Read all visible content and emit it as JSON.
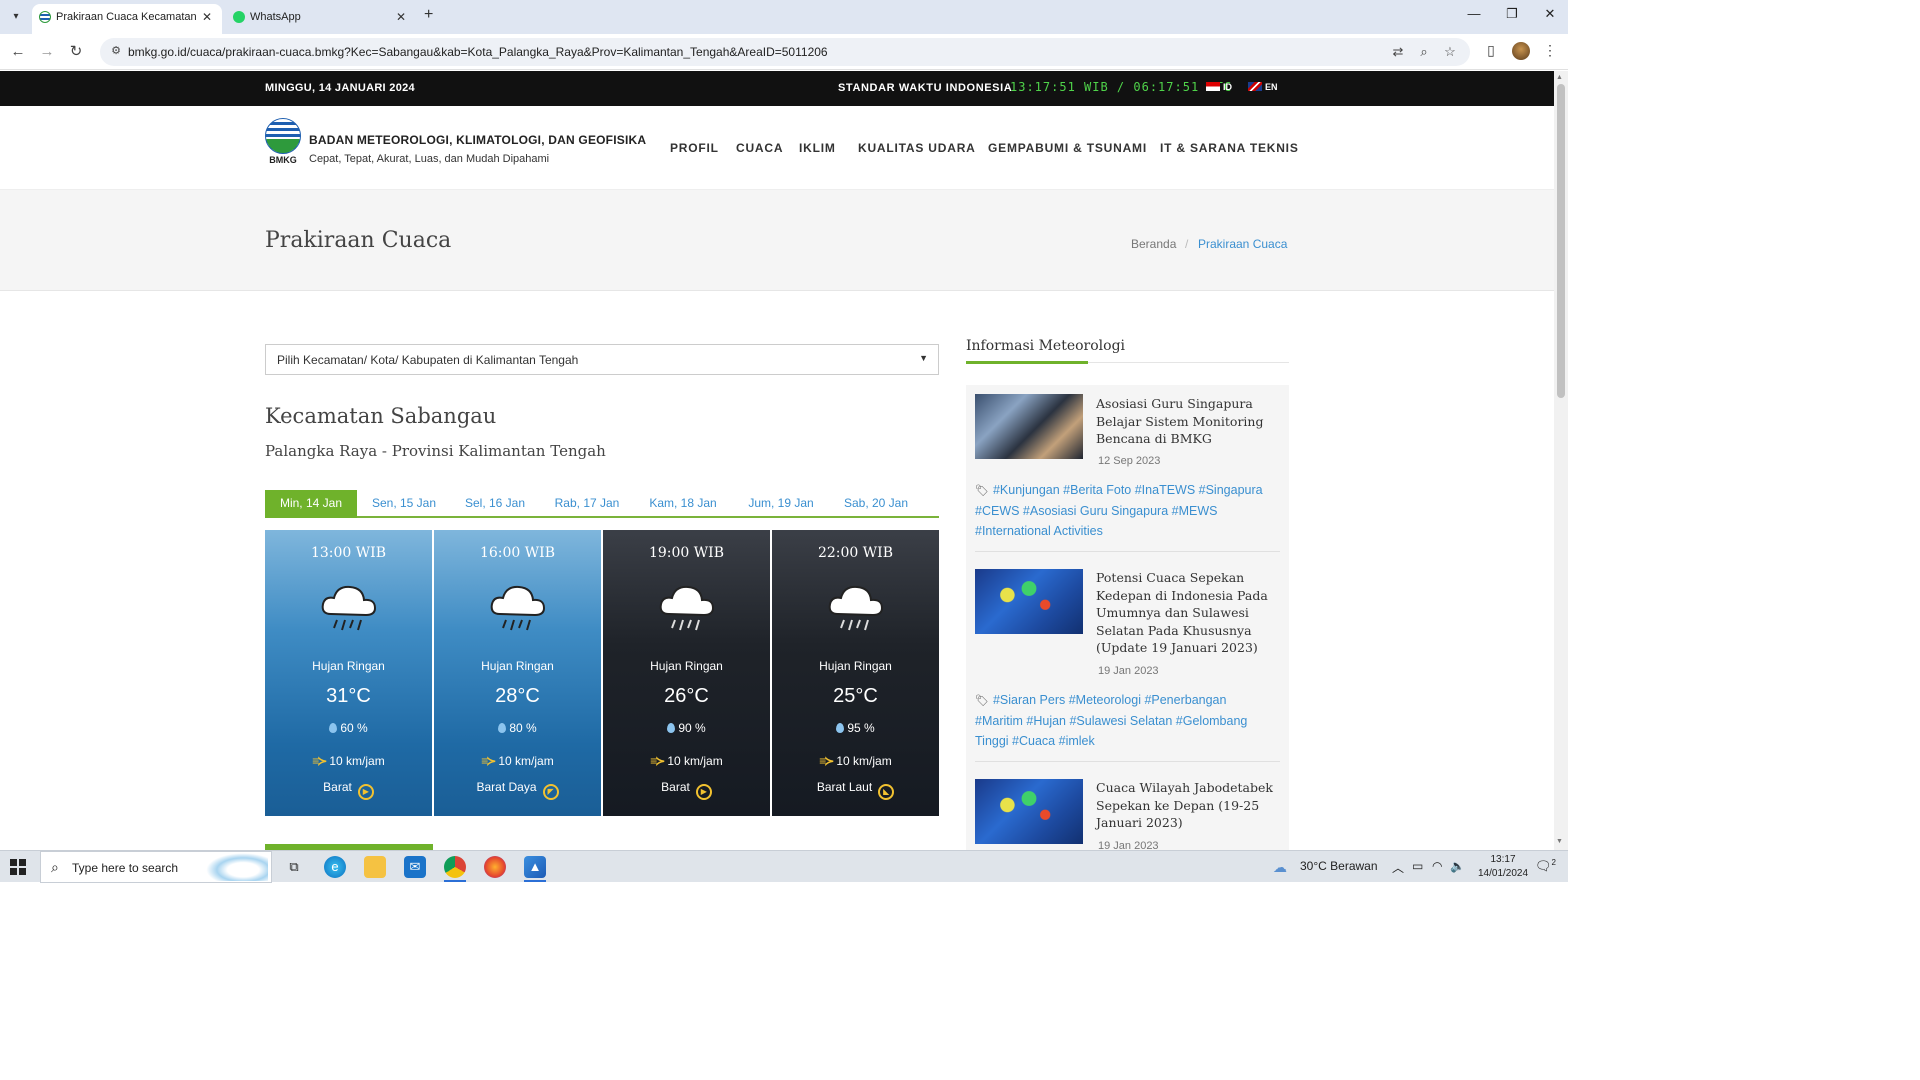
{
  "browser": {
    "tabs": [
      {
        "title": "Prakiraan Cuaca Kecamatan Sab",
        "active": true
      },
      {
        "title": "WhatsApp",
        "active": false
      }
    ],
    "url": "bmkg.go.id/cuaca/prakiraan-cuaca.bmkg?Kec=Sabangau&kab=Kota_Palangka_Raya&Prov=Kalimantan_Tengah&AreaID=5011206"
  },
  "topbar": {
    "date": "MINGGU, 14 JANUARI 2024",
    "standard_time_label": "STANDAR WAKTU INDONESIA",
    "clock": "13:17:51 WIB / 06:17:51 UTC",
    "lang_id": "ID",
    "lang_en": "EN"
  },
  "header": {
    "logo_text": "BMKG",
    "org_name": "BADAN METEOROLOGI, KLIMATOLOGI, DAN GEOFISIKA",
    "tagline": "Cepat, Tepat, Akurat, Luas, dan Mudah Dipahami",
    "nav": [
      "PROFIL",
      "CUACA",
      "IKLIM",
      "KUALITAS UDARA",
      "GEMPABUMI & TSUNAMI",
      "IT & SARANA TEKNIS"
    ]
  },
  "page": {
    "title": "Prakiraan Cuaca",
    "breadcrumb": {
      "home": "Beranda",
      "separator": "/",
      "current": "Prakiraan Cuaca"
    }
  },
  "main": {
    "select_placeholder": "Pilih Kecamatan/ Kota/ Kabupaten di Kalimantan Tengah",
    "kecamatan": "Kecamatan Sabangau",
    "location": "Palangka Raya - Provinsi Kalimantan Tengah",
    "day_tabs": [
      "Min, 14 Jan",
      "Sen, 15 Jan",
      "Sel, 16 Jan",
      "Rab, 17 Jan",
      "Kam, 18 Jan",
      "Jum, 19 Jan",
      "Sab, 20 Jan"
    ],
    "active_day": "Min, 14 Jan",
    "forecasts": [
      {
        "time": "13:00 WIB",
        "condition": "Hujan Ringan",
        "temp": "31°C",
        "humidity": "60 %",
        "wind_speed": "10 km/jam",
        "wind_dir": "Barat",
        "theme": "day"
      },
      {
        "time": "16:00 WIB",
        "condition": "Hujan Ringan",
        "temp": "28°C",
        "humidity": "80 %",
        "wind_speed": "10 km/jam",
        "wind_dir": "Barat Daya",
        "theme": "day"
      },
      {
        "time": "19:00 WIB",
        "condition": "Hujan Ringan",
        "temp": "26°C",
        "humidity": "90 %",
        "wind_speed": "10 km/jam",
        "wind_dir": "Barat",
        "theme": "night"
      },
      {
        "time": "22:00 WIB",
        "condition": "Hujan Ringan",
        "temp": "25°C",
        "humidity": "95 %",
        "wind_speed": "10 km/jam",
        "wind_dir": "Barat Laut",
        "theme": "night"
      }
    ]
  },
  "sidebar": {
    "heading": "Informasi Meteorologi",
    "news": [
      {
        "title": "Asosiasi Guru Singapura Belajar Sistem Monitoring Bencana di BMKG",
        "date": "12 Sep 2023",
        "tags": "#Kunjungan #Berita Foto #InaTEWS #Singapura #CEWS #Asosiasi Guru Singapura #MEWS #International Activities"
      },
      {
        "title": "Potensi Cuaca Sepekan Kedepan di Indonesia Pada Umumnya dan Sulawesi Selatan Pada Khususnya (Update 19 Januari 2023)",
        "date": "19 Jan 2023",
        "tags": "#Siaran Pers #Meteorologi #Penerbangan #Maritim #Hujan #Sulawesi Selatan #Gelombang Tinggi #Cuaca #imlek"
      },
      {
        "title": "Cuaca Wilayah Jabodetabek Sepekan ke Depan (19-25 Januari 2023)",
        "date": "19 Jan 2023",
        "tags": ""
      }
    ]
  },
  "taskbar": {
    "search_placeholder": "Type here to search",
    "weather": "30°C  Berawan",
    "time": "13:17",
    "date": "14/01/2024",
    "notifications": "2"
  },
  "colors": {
    "accent_green": "#6fb22b",
    "link_blue": "#3a8fd0",
    "clock_green": "#4fd34a"
  }
}
